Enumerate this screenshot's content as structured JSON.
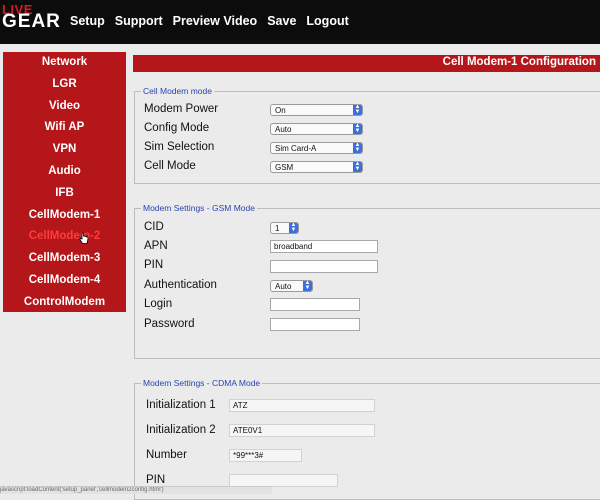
{
  "logo": {
    "line1": "LIVE",
    "line2": "GEAR"
  },
  "nav": [
    "Setup",
    "Support",
    "Preview Video",
    "Save",
    "Logout"
  ],
  "sidebar": [
    {
      "label": "Network"
    },
    {
      "label": "LGR"
    },
    {
      "label": "Video"
    },
    {
      "label": "Wifi AP"
    },
    {
      "label": "VPN"
    },
    {
      "label": "Audio"
    },
    {
      "label": "IFB"
    },
    {
      "label": "CellModem-1"
    },
    {
      "label": "CellModem-2",
      "active": true
    },
    {
      "label": "CellModem-3"
    },
    {
      "label": "CellModem-4"
    },
    {
      "label": "ControlModem"
    }
  ],
  "page_title": "Cell Modem-1 Configuration",
  "cell_modem_mode": {
    "legend": "Cell Modem mode",
    "modem_power": {
      "label": "Modem Power",
      "value": "On"
    },
    "config_mode": {
      "label": "Config Mode",
      "value": "Auto"
    },
    "sim_selection": {
      "label": "Sim Selection",
      "value": "Sim Card-A"
    },
    "cell_mode": {
      "label": "Cell Mode",
      "value": "GSM"
    }
  },
  "gsm": {
    "legend": "Modem Settings - GSM Mode",
    "cid": {
      "label": "CID",
      "value": "1"
    },
    "apn": {
      "label": "APN",
      "value": "broadband"
    },
    "pin": {
      "label": "PIN",
      "value": ""
    },
    "authentication": {
      "label": "Authentication",
      "value": "Auto"
    },
    "login": {
      "label": "Login",
      "value": ""
    },
    "password": {
      "label": "Password",
      "value": ""
    }
  },
  "cdma": {
    "legend": "Modem Settings - CDMA Mode",
    "init1": {
      "label": "Initialization 1",
      "value": "ATZ"
    },
    "init2": {
      "label": "Initialization 2",
      "value": "ATE0V1"
    },
    "number": {
      "label": "Number",
      "value": "*99***3#"
    },
    "pin": {
      "label": "PIN",
      "value": ""
    }
  },
  "status_text": "javascript:loadContent('setup_panel','cellmodem2config.html')"
}
